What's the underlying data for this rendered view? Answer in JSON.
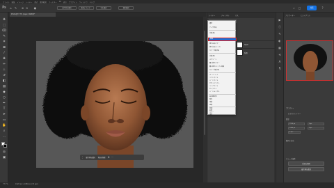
{
  "app": {
    "menus": [
      "ファイル",
      "編集",
      "イメージ",
      "レイヤー",
      "書式",
      "選択範囲",
      "フィルター",
      "3D",
      "表示",
      "プラグイン",
      "ウィンドウ",
      "ヘルプ"
    ],
    "logo_icon": "photoshop-logo-icon",
    "share_label": "共有"
  },
  "options_bar": {
    "buttons": [
      "被写体を選択",
      "選択とマスク...",
      "空を選択",
      "選択範囲"
    ],
    "icons": [
      "home-icon",
      "move-icon",
      "select-icon",
      "brush-icon"
    ]
  },
  "document": {
    "tab_title": "Photo@77.7% (layer, RGB/8)*"
  },
  "taskbar": {
    "buttons": [
      "被写体を選択",
      "背景を削除"
    ],
    "icons": [
      "more-icon",
      "settings-icon"
    ]
  },
  "status": {
    "zoom": "77.7%",
    "doc_info": "1920 px x 1080 px (72 ppi)"
  },
  "layers_panel": {
    "tabs": [
      "レイヤー",
      "チャンネル",
      "パス"
    ],
    "blend_mode": "通常",
    "layers": [
      {
        "name": "layer"
      },
      {
        "name": "背景"
      }
    ]
  },
  "dropdown": {
    "groups": [
      [
        "通常",
        "ディザ合成"
      ],
      [
        "比較(暗)",
        "乗算",
        "焼き込みカラー",
        "焼き込み(リニア)",
        "カラー比較(暗)"
      ],
      [
        "比較(明)",
        "スクリーン",
        "覆い焼きカラー",
        "覆い焼き(リニア)-加算",
        "カラー比較(明)"
      ],
      [
        "オーバーレイ",
        "ソフトライト",
        "ハードライト",
        "ビビッドライト",
        "リニアライト",
        "ピンライト",
        "ハードミックス"
      ],
      [
        "差の絶対値",
        "除外",
        "減算",
        "除算"
      ],
      [
        "色相",
        "彩度",
        "カラー",
        "輝度"
      ]
    ],
    "selected": "乗算"
  },
  "right_panel": {
    "tabs": [
      "ナビゲーター",
      "ヒストグラム"
    ],
    "section_properties": "プロパティ",
    "layer_kind": "ピクセルレイヤー",
    "transform_label": "変形",
    "w_value": "1920 px",
    "h_value": "1080 px",
    "x_value": "0 px",
    "y_value": "0 px",
    "angle": "0.00°",
    "align_label": "整列と分布",
    "quick_actions_label": "クイック操作",
    "quick_actions": [
      "背景を削除",
      "被写体を選択"
    ]
  },
  "colors": {
    "accent": "#1473e6",
    "highlight_border": "#e02020",
    "selection": "#1d6fd6"
  }
}
